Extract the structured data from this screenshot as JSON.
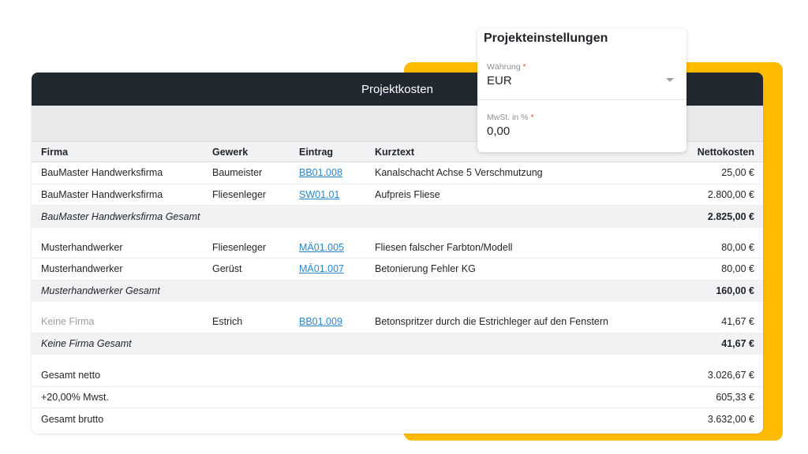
{
  "card": {
    "title": "Projektkosten"
  },
  "table": {
    "headers": {
      "firma": "Firma",
      "gewerk": "Gewerk",
      "eintrag": "Eintrag",
      "kurztext": "Kurztext",
      "netto": "Nettokosten"
    },
    "group1": {
      "rows": [
        {
          "firma": "BauMaster Handwerksfirma",
          "gewerk": "Baumeister",
          "eintrag": "BB01.008",
          "kurztext": "Kanalschacht Achse 5 Verschmutzung",
          "netto": "25,00 €"
        },
        {
          "firma": "BauMaster Handwerksfirma",
          "gewerk": "Fliesenleger",
          "eintrag": "SW01.01",
          "kurztext": "Aufpreis Fliese",
          "netto": "2.800,00 €"
        }
      ],
      "subtotal": {
        "label": "BauMaster Handwerksfirma Gesamt",
        "value": "2.825,00 €"
      }
    },
    "group2": {
      "rows": [
        {
          "firma": "Musterhandwerker",
          "gewerk": "Fliesenleger",
          "eintrag": "MÄ01.005",
          "kurztext": "Fliesen falscher Farbton/Modell",
          "netto": "80,00 €"
        },
        {
          "firma": "Musterhandwerker",
          "gewerk": "Gerüst",
          "eintrag": "MÄ01.007",
          "kurztext": "Betonierung Fehler KG",
          "netto": "80,00 €"
        }
      ],
      "subtotal": {
        "label": "Musterhandwerker Gesamt",
        "value": "160,00 €"
      }
    },
    "group3": {
      "rows": [
        {
          "firma": "Keine Firma",
          "gewerk": "Estrich",
          "eintrag": "BB01.009",
          "kurztext": "Betonspritzer durch die Estrichleger auf den Fenstern",
          "netto": "41,67 €"
        }
      ],
      "subtotal": {
        "label": "Keine Firma Gesamt",
        "value": "41,67 €"
      }
    },
    "totals": {
      "netto": {
        "label": "Gesamt netto",
        "value": "3.026,67 €"
      },
      "mwst": {
        "label": "+20,00% Mwst.",
        "value": "605,33 €"
      },
      "brutto": {
        "label": "Gesamt brutto",
        "value": "3.632,00 €"
      }
    }
  },
  "settings": {
    "title": "Projekteinstellungen",
    "currency": {
      "label": "Währung",
      "required_mark": "*",
      "value": "EUR"
    },
    "vat": {
      "label": "MwSt. in %",
      "required_mark": "*",
      "value": "0,00"
    }
  },
  "colors": {
    "accent": "#ffbb00",
    "header_bg": "#212830",
    "link": "#2a86c8"
  },
  "icons": {
    "currency_dropdown": "chevron-down-icon"
  }
}
